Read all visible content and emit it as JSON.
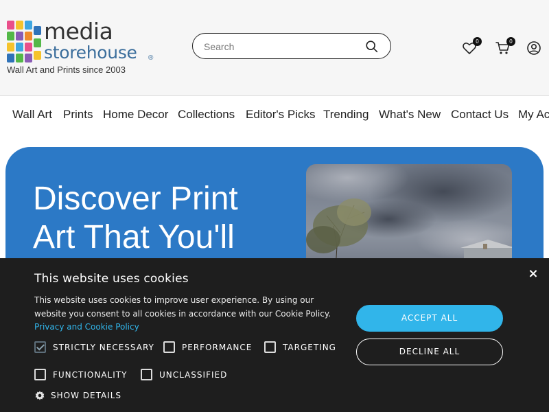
{
  "header": {
    "logo": {
      "line1": "media",
      "line2": "storehouse",
      "reg": "®"
    },
    "tagline": "Wall Art and Prints since 2003",
    "search": {
      "placeholder": "Search"
    },
    "wishlist_count": "0",
    "cart_count": "0"
  },
  "nav": {
    "items": [
      "Wall Art",
      "Prints",
      "Home Decor",
      "Collections",
      "Editor's Picks",
      "Trending",
      "What's New",
      "Contact Us",
      "My Account"
    ]
  },
  "hero": {
    "title": "Discover Print Art That You'll"
  },
  "cookie": {
    "title": "This website uses cookies",
    "text": "This website uses cookies to improve user experience. By using our website you consent to all cookies in accordance with our Cookie Policy. ",
    "link": "Privacy and Cookie Policy",
    "options": [
      {
        "label": "STRICTLY NECESSARY",
        "checked": true
      },
      {
        "label": "PERFORMANCE",
        "checked": false
      },
      {
        "label": "TARGETING",
        "checked": false
      },
      {
        "label": "FUNCTIONALITY",
        "checked": false
      },
      {
        "label": "UNCLASSIFIED",
        "checked": false
      }
    ],
    "show_details": "SHOW DETAILS",
    "accept": "ACCEPT ALL",
    "decline": "DECLINE ALL",
    "close": "×"
  },
  "colors": {
    "hero_bg": "#2c79c6",
    "accent": "#31b5ea",
    "banner_bg": "#1e1e1e"
  }
}
